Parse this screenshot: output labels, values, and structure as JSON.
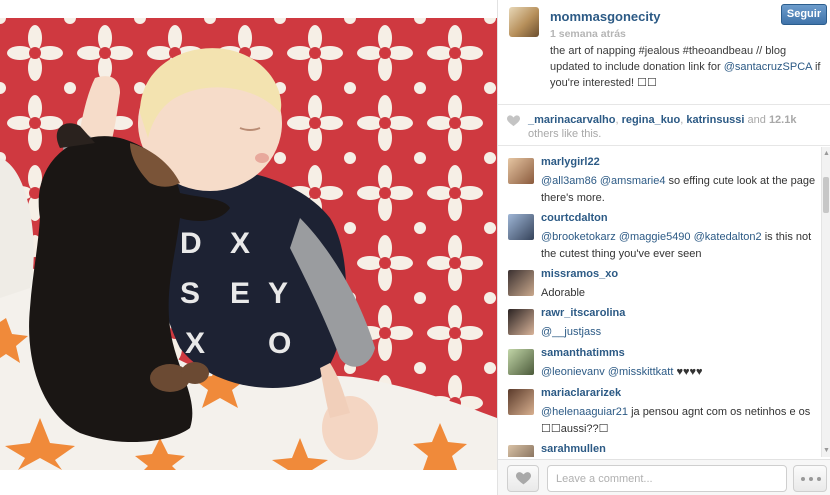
{
  "post": {
    "username": "mommasgonecity",
    "time_ago": "1 semana atrás",
    "follow_label": "Seguir",
    "caption_parts": {
      "p1": "the art of napping #jealous #theoandbeau // blog updated to include donation link for ",
      "mention": "@santacruzSPCA",
      "p2": " if you're interested! ",
      "p3": "☐☐"
    }
  },
  "likes": {
    "user1": "_marinacarvalho",
    "user2": "regina_kuo",
    "user3": "katrinsussi",
    "and": " and ",
    "count": "12.1k",
    "others": "others like this."
  },
  "comments": [
    {
      "user": "marlygirl22",
      "m1": "@all3am86",
      "m2": "@amsmarie4",
      "text": " so effing cute look at the page there's more."
    },
    {
      "user": "courtcdalton",
      "m1": "@brooketokarz",
      "m2": "@maggie5490",
      "m3": "@katedalton2",
      "text": " is this not the cutest thing you've ever seen"
    },
    {
      "user": "missramos_xo",
      "text": "Adorable"
    },
    {
      "user": "rawr_itscarolina",
      "m1": "@__justjass"
    },
    {
      "user": "samanthatimms",
      "m1": "@leonievanv",
      "m2": "@misskittkatt",
      "text": " ♥♥♥♥"
    },
    {
      "user": "mariaclararizek",
      "m1": "@helenaaguiar21",
      "text": " ja pensou agnt com os netinhos e os ☐☐aussi??☐"
    },
    {
      "user": "sarahmullen"
    }
  ],
  "footer": {
    "comment_placeholder": "Leave a comment..."
  },
  "colors": {
    "link": "#2c5a85",
    "follow_button": "#3f73a9",
    "photo_background": "#c9343b"
  }
}
